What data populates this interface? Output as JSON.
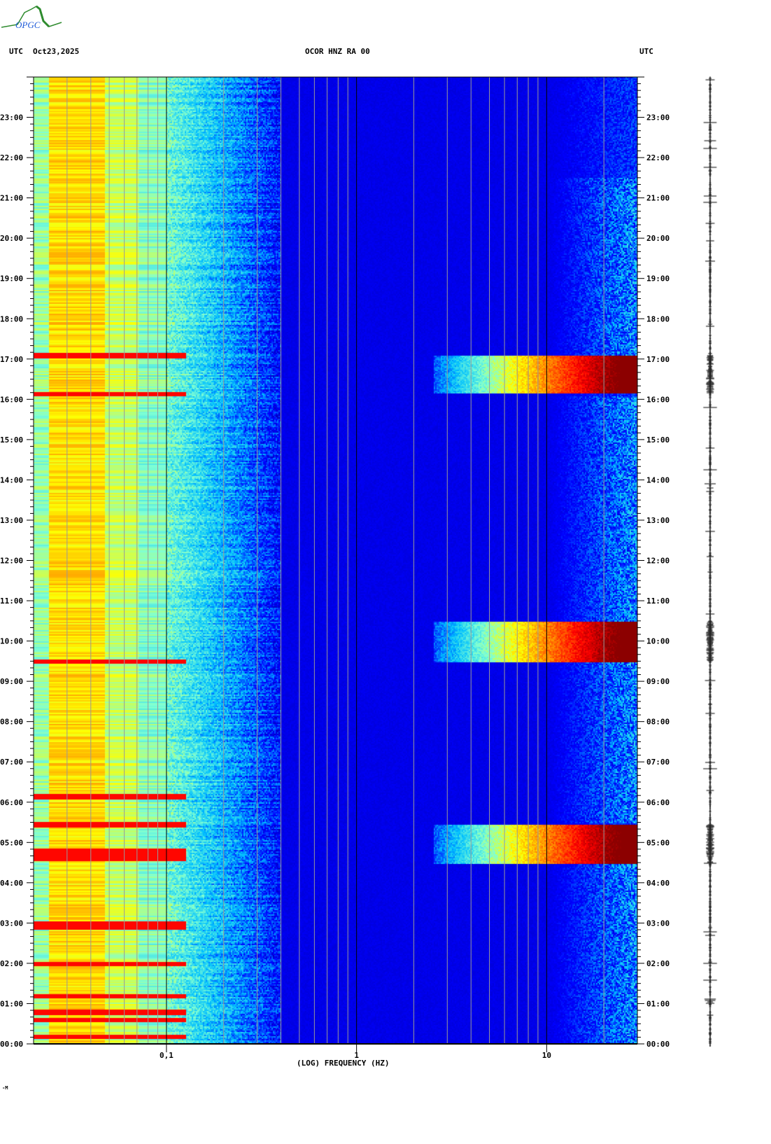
{
  "header": {
    "logo_text": "OPGC",
    "left_label": "UTC",
    "date": "Oct23,2025",
    "station": "OCOR HNZ RA 00",
    "right_label": "UTC"
  },
  "footer_mark": "-M",
  "chart_data": {
    "type": "heatmap",
    "title": "OCOR HNZ RA 00",
    "xlabel": "(LOG) FREQUENCY (HZ)",
    "ylabel": "UTC",
    "x_scale": "log",
    "xlim": [
      0.02,
      30
    ],
    "ylim_hours": [
      0,
      24
    ],
    "x_tick_labels": [
      {
        "value": 0.1,
        "label": "0,1"
      },
      {
        "value": 1,
        "label": "1"
      },
      {
        "value": 10,
        "label": "10"
      }
    ],
    "x_gridlines": [
      0.03,
      0.04,
      0.05,
      0.06,
      0.07,
      0.08,
      0.09,
      0.1,
      0.2,
      0.3,
      0.4,
      0.5,
      0.6,
      0.7,
      0.8,
      0.9,
      1,
      2,
      3,
      4,
      5,
      6,
      7,
      8,
      9,
      10,
      20
    ],
    "y_tick_labels": [
      "00:00",
      "01:00",
      "02:00",
      "03:00",
      "04:00",
      "05:00",
      "06:00",
      "07:00",
      "08:00",
      "09:00",
      "10:00",
      "11:00",
      "12:00",
      "13:00",
      "14:00",
      "15:00",
      "16:00",
      "17:00",
      "18:00",
      "19:00",
      "20:00",
      "21:00",
      "22:00",
      "23:00"
    ],
    "colormap": [
      "#00008b",
      "#0000ff",
      "#00bfff",
      "#7fffd4",
      "#ffff00",
      "#ff8000",
      "#ff0000",
      "#8b0000"
    ],
    "broadband_events_hours": [
      [
        16.15,
        17.1
      ],
      [
        9.5,
        10.5
      ],
      [
        4.5,
        5.45
      ]
    ],
    "low_freq_lines_hours": [
      17.1,
      16.15,
      9.5,
      5.45,
      6.15,
      2.0,
      1.2,
      0.8,
      0.6,
      0.2,
      4.6,
      4.7,
      4.8,
      2.9,
      3.0
    ],
    "daytime_hf_noise_hours": [
      [
        0,
        4.5
      ],
      [
        5.5,
        9.5
      ],
      [
        10.5,
        16.1
      ],
      [
        17.1,
        21.5
      ]
    ]
  }
}
